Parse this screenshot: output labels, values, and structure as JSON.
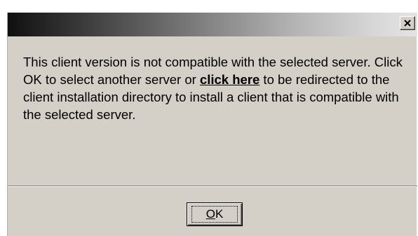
{
  "dialog": {
    "title": "",
    "close_glyph": "✕",
    "message": {
      "before_link": "This client version is not compatible with the selected server. Click OK to select another server or ",
      "link_text": "click here",
      "after_link": " to be redirected to the client installation directory to install a client that is compatible with the selected server."
    },
    "ok_button": {
      "mnemonic": "O",
      "rest": "K"
    }
  },
  "icons": {
    "close": "close-icon"
  },
  "colors": {
    "dialog_background": "#d4d0c8",
    "titlebar_start": "#101010",
    "titlebar_end": "#e4e4e4"
  }
}
